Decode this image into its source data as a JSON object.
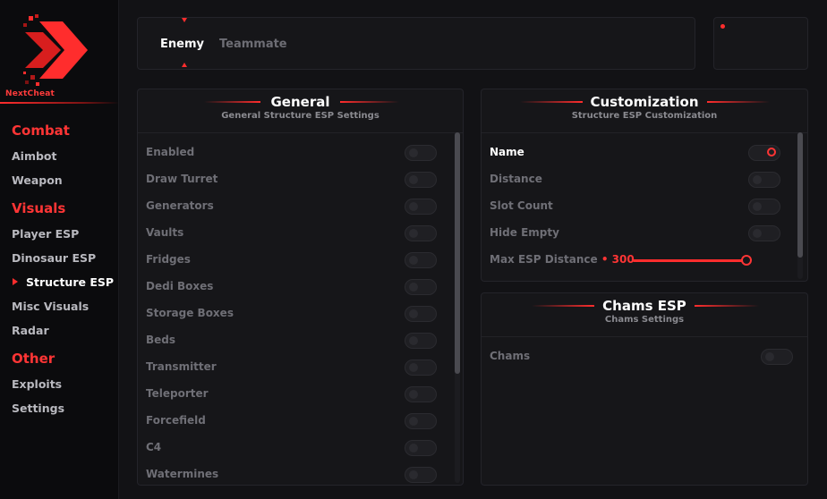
{
  "brand": {
    "name": "NextCheat"
  },
  "sidebar": {
    "sections": [
      {
        "label": "Combat",
        "items": [
          {
            "label": "Aimbot"
          },
          {
            "label": "Weapon"
          }
        ]
      },
      {
        "label": "Visuals",
        "items": [
          {
            "label": "Player ESP"
          },
          {
            "label": "Dinosaur ESP"
          },
          {
            "label": "Structure ESP",
            "active": true
          },
          {
            "label": "Misc Visuals"
          },
          {
            "label": "Radar"
          }
        ]
      },
      {
        "label": "Other",
        "items": [
          {
            "label": "Exploits"
          },
          {
            "label": "Settings"
          }
        ]
      }
    ]
  },
  "tabs": [
    {
      "label": "Enemy",
      "active": true
    },
    {
      "label": "Teammate",
      "active": false
    }
  ],
  "general": {
    "title": "General",
    "subtitle": "General Structure ESP Settings",
    "options": [
      {
        "label": "Enabled",
        "on": false
      },
      {
        "label": "Draw Turret",
        "on": false
      },
      {
        "label": "Generators",
        "on": false
      },
      {
        "label": "Vaults",
        "on": false
      },
      {
        "label": "Fridges",
        "on": false
      },
      {
        "label": "Dedi Boxes",
        "on": false
      },
      {
        "label": "Storage Boxes",
        "on": false
      },
      {
        "label": "Beds",
        "on": false
      },
      {
        "label": "Transmitter",
        "on": false
      },
      {
        "label": "Teleporter",
        "on": false
      },
      {
        "label": "Forcefield",
        "on": false
      },
      {
        "label": "C4",
        "on": false
      },
      {
        "label": "Watermines",
        "on": false
      }
    ]
  },
  "customization": {
    "title": "Customization",
    "subtitle": "Structure ESP Customization",
    "options": [
      {
        "label": "Name",
        "on": true
      },
      {
        "label": "Distance",
        "on": false
      },
      {
        "label": "Slot Count",
        "on": false
      },
      {
        "label": "Hide Empty",
        "on": false
      }
    ],
    "slider": {
      "label": "Max ESP Distance",
      "bullet": "•",
      "value": "300",
      "fraction": 0.8
    }
  },
  "chams": {
    "title": "Chams ESP",
    "subtitle": "Chams Settings",
    "options": [
      {
        "label": "Chams",
        "on": false
      }
    ]
  },
  "colors": {
    "accent": "#ff2d2d",
    "background": "#121215",
    "panel": "#161619"
  }
}
